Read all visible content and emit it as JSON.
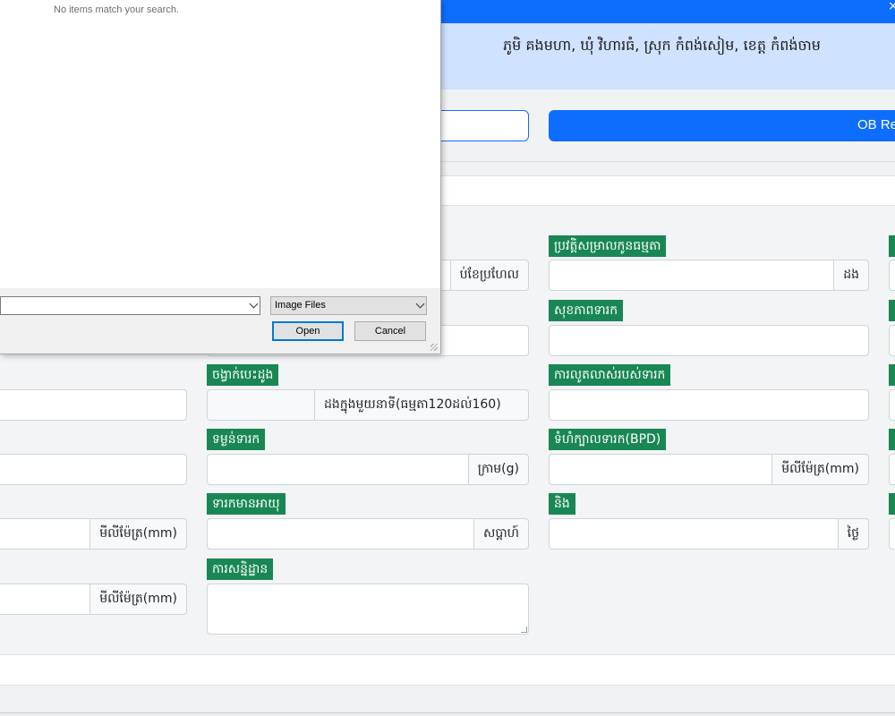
{
  "header": {
    "close_glyph": "×",
    "address": "ភូមិ គងមហា, ឃុំ វិហារធំ, ស្រុក កំពង់សៀម, ខេត្ត កំពង់ចាម"
  },
  "actions": {
    "ob_report_label": "OB Rep"
  },
  "form": {
    "col1": {
      "unit_mm_1": "មីលីម៉ែត្រ(mm)",
      "unit_mm_2": "មីលីម៉ែត្រ(mm)"
    },
    "col2": {
      "lmp_suffix": "ប់ខែប្រហែល",
      "heartbeat_label": "ចង្វាក់បេះដូង",
      "heartbeat_suffix": "ដងក្នុងមួយនាទី(ធម្មតា120ដល់160)",
      "fetal_weight_label": "ទម្ងន់ទារក",
      "fetal_weight_suffix": "ក្រាម(g)",
      "fetal_age_label": "ទារកមានអាយុ",
      "fetal_age_suffix": "សប្តាហ៍",
      "conclusion_label": "ការសន្និដ្ឋាន"
    },
    "col3": {
      "pregnancy_history_label": "ប្រវត្តិសម្រាលកូនធម្មតា",
      "pregnancy_history_suffix": "ដង",
      "fetal_health_label": "សុខភាពទារក",
      "fetal_movement_label": "ការលូតលាស់របស់ទារក",
      "bpd_label": "ទំហំក្បាលទារក(BPD)",
      "bpd_suffix": "មីលីម៉ែត្រ(mm)",
      "and_label": "និង",
      "day_suffix": "ថ្ងៃ"
    }
  },
  "file_dialog": {
    "empty_message": "No items match your search.",
    "file_type": "Image Files",
    "open_label": "Open",
    "cancel_label": "Cancel"
  }
}
